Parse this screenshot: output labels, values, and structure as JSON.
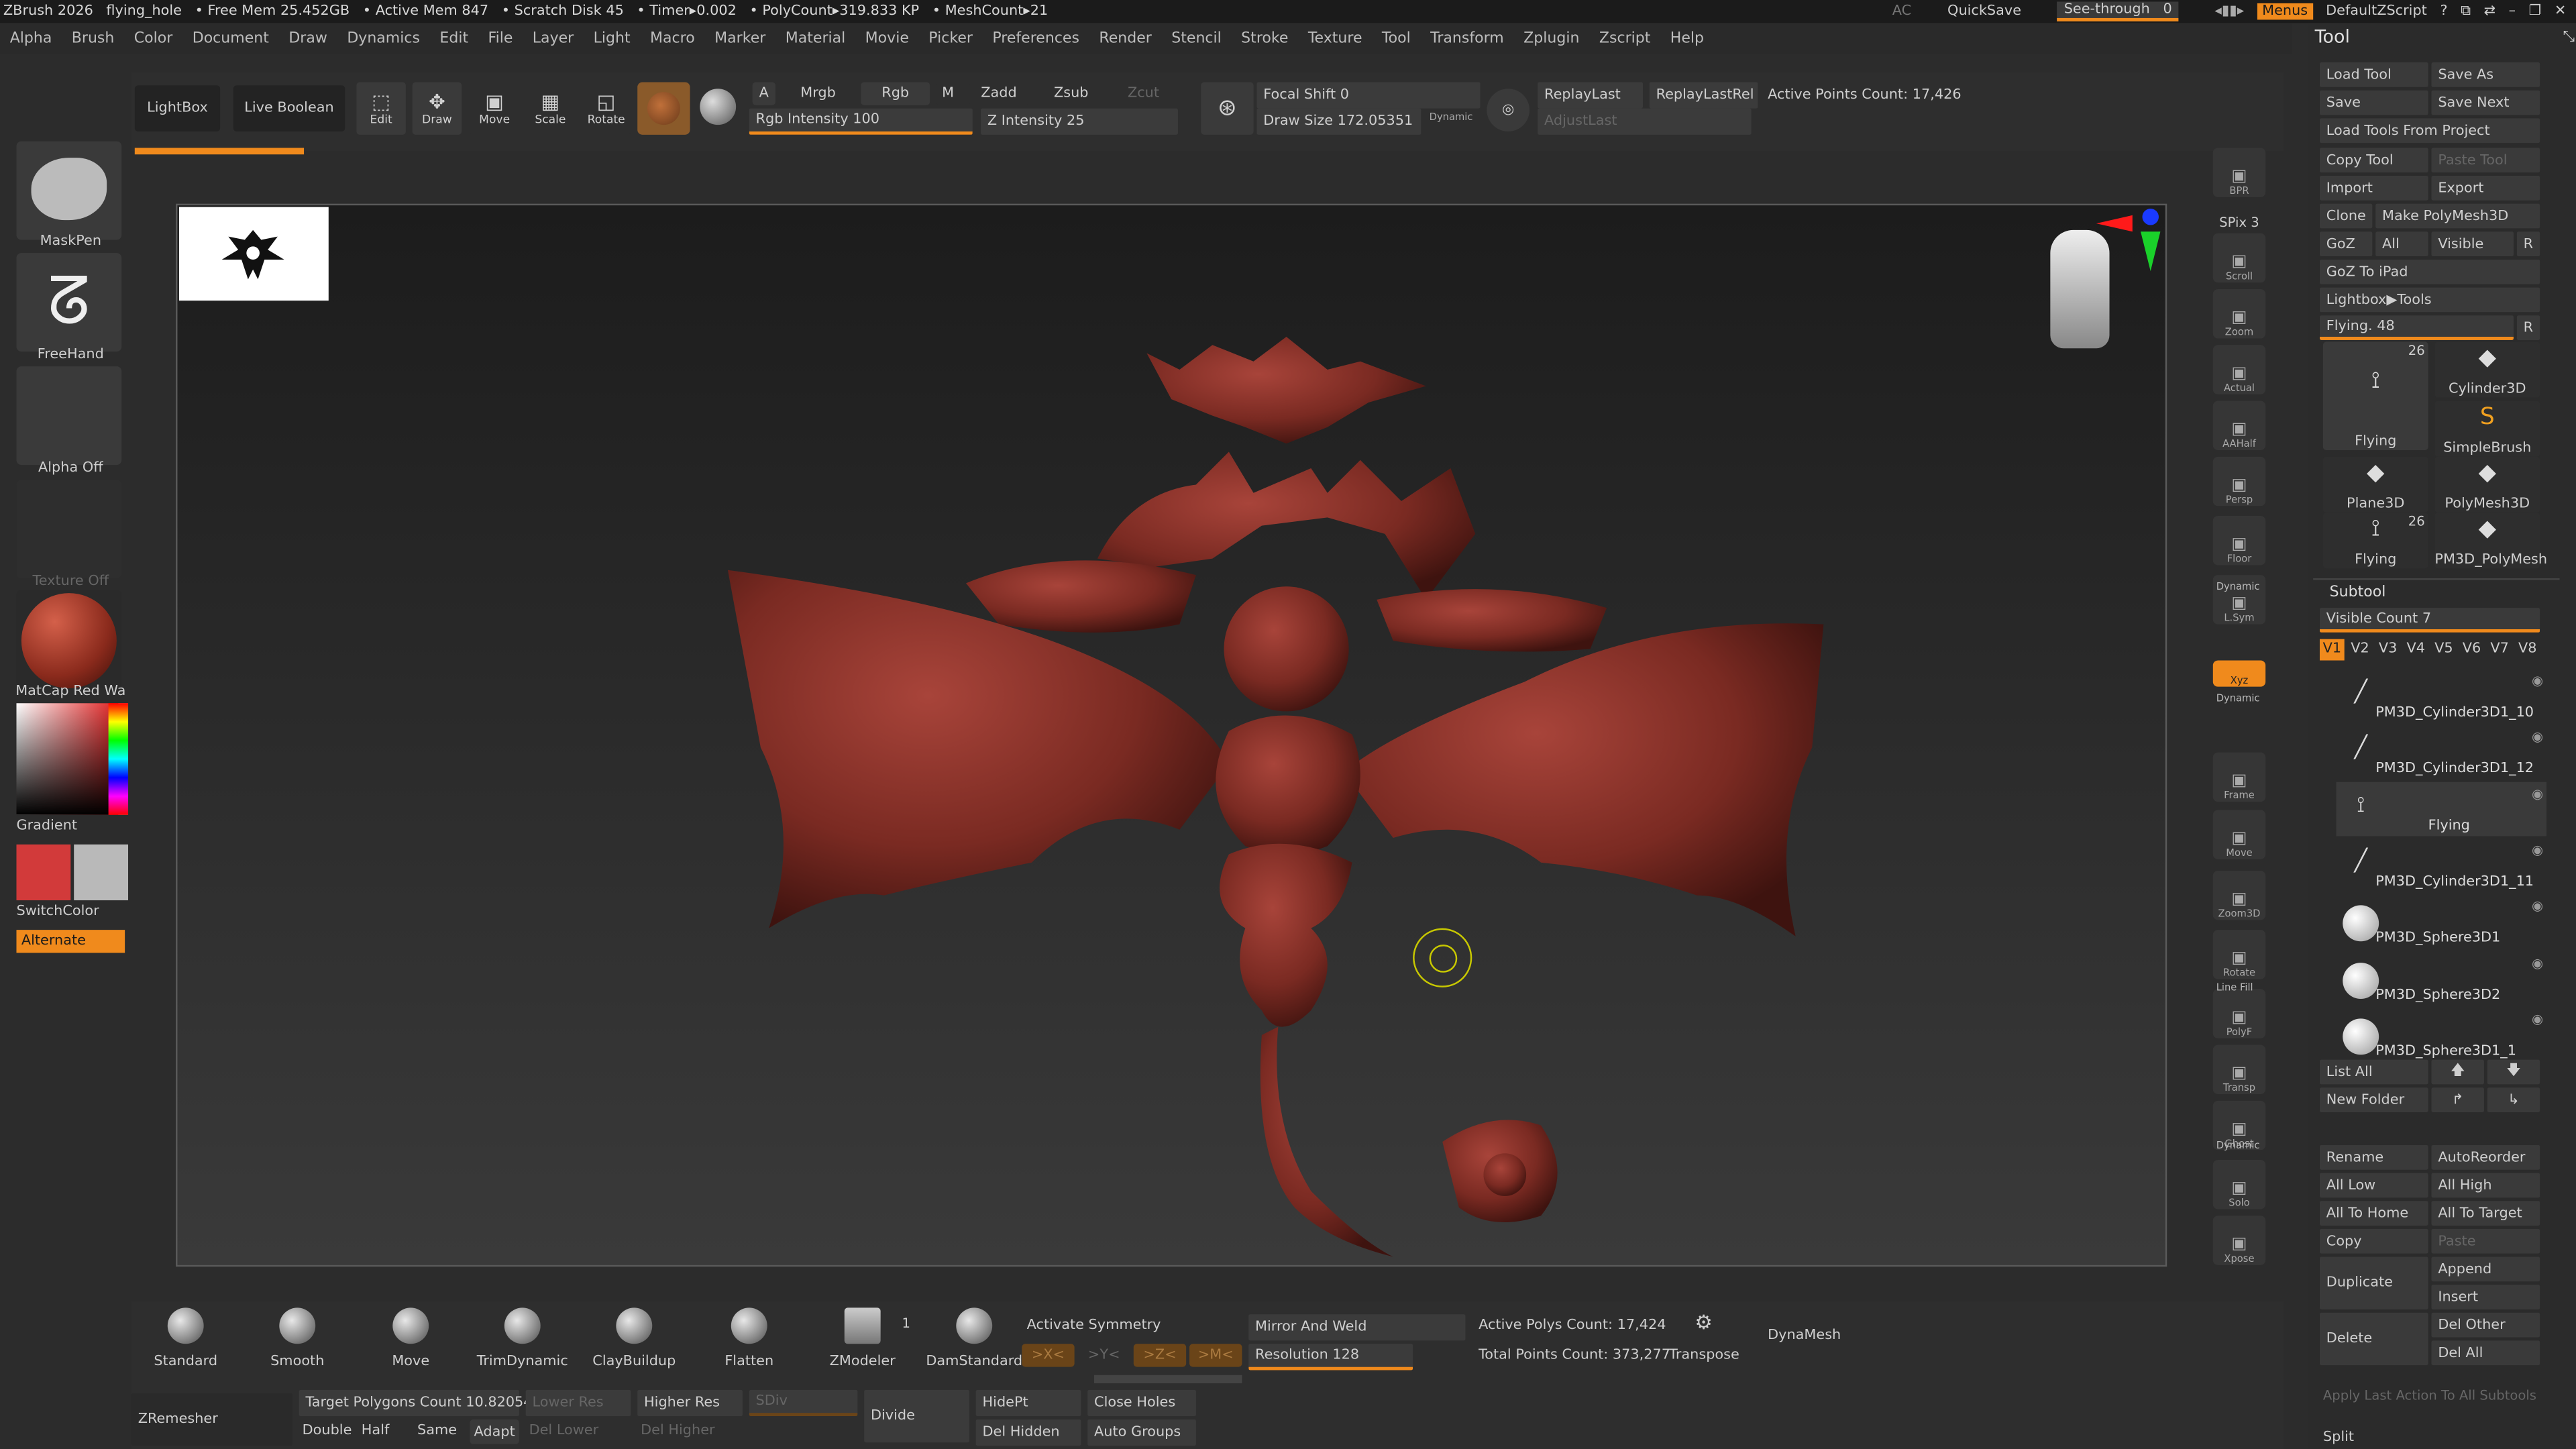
{
  "titlebar": {
    "app": "ZBrush 2026",
    "file": "flying_hole",
    "free_mem": "• Free Mem 25.452GB",
    "active_mem": "• Active Mem 847",
    "scratch": "• Scratch Disk 45",
    "timer": "• Timer▸0.002",
    "polycount": "• PolyCount▸319.833 KP",
    "meshcount": "• MeshCount▸21",
    "ac": "AC",
    "quicksave": "QuickSave",
    "seethrough": "See-through",
    "seethrough_val": "0",
    "menus": "Menus",
    "zscript": "DefaultZScript"
  },
  "menubar": [
    "Alpha",
    "Brush",
    "Color",
    "Document",
    "Draw",
    "Dynamics",
    "Edit",
    "File",
    "Layer",
    "Light",
    "Macro",
    "Marker",
    "Material",
    "Movie",
    "Picker",
    "Preferences",
    "Render",
    "Stencil",
    "Stroke",
    "Texture",
    "Tool",
    "Transform",
    "Zplugin",
    "Zscript",
    "Help"
  ],
  "toolbar": {
    "lightbox": "LightBox",
    "live_boolean": "Live Boolean",
    "edit": "Edit",
    "draw": "Draw",
    "move": "Move",
    "scale": "Scale",
    "rotate": "Rotate",
    "a": "A",
    "mrgb": "Mrgb",
    "rgb": "Rgb",
    "m": "M",
    "zadd": "Zadd",
    "zsub": "Zsub",
    "zcut": "Zcut",
    "rgb_intensity": "Rgb Intensity 100",
    "z_intensity": "Z Intensity 25",
    "focal_shift": "Focal Shift 0",
    "draw_size": "Draw Size 172.05351",
    "dynamic": "Dynamic",
    "replay_last": "ReplayLast",
    "replay_last_rel": "ReplayLastRel",
    "active_points": "Active Points Count: 17,426",
    "adjust_last": "AdjustLast"
  },
  "leftpanel": {
    "brush": "MaskPen",
    "stroke": "FreeHand",
    "alpha": "Alpha Off",
    "texture": "Texture Off",
    "material": "MatCap Red Wa",
    "gradient": "Gradient",
    "switchcolor": "SwitchColor",
    "alternate": "Alternate"
  },
  "rightrail": [
    {
      "label": "BPR",
      "icon": "bpr-icon"
    },
    {
      "label": "SPix 3",
      "icon": "spix-icon"
    },
    {
      "label": "Scroll",
      "icon": "scroll-icon"
    },
    {
      "label": "Zoom",
      "icon": "zoom-icon"
    },
    {
      "label": "Actual",
      "icon": "actual-icon"
    },
    {
      "label": "AAHalf",
      "icon": "aahalf-icon"
    },
    {
      "label": "Persp",
      "icon": "persp-icon"
    },
    {
      "label": "Floor",
      "icon": "floor-icon"
    },
    {
      "label": "L.Sym",
      "icon": "lsym-icon"
    },
    {
      "label": "Xyz",
      "icon": "xyz-icon"
    },
    {
      "label": "Frame",
      "icon": "frame-icon"
    },
    {
      "label": "Move",
      "icon": "move-icon"
    },
    {
      "label": "Zoom3D",
      "icon": "zoom3d-icon"
    },
    {
      "label": "Rotate",
      "icon": "rotate-icon"
    },
    {
      "label": "PolyF",
      "icon": "polyf-icon"
    },
    {
      "label": "Transp",
      "icon": "transp-icon"
    },
    {
      "label": "Ghost",
      "icon": "ghost-icon"
    },
    {
      "label": "Solo",
      "icon": "solo-icon"
    },
    {
      "label": "Xpose",
      "icon": "xpose-icon"
    }
  ],
  "rail_dynamic": "Dynamic",
  "rail_linefill": "Line Fill",
  "toolpanel": {
    "title": "Tool",
    "load_tool": "Load Tool",
    "save_as": "Save As",
    "save": "Save",
    "save_next": "Save Next",
    "load_from_project": "Load Tools From Project",
    "copy_tool": "Copy Tool",
    "paste_tool": "Paste Tool",
    "import": "Import",
    "export": "Export",
    "clone": "Clone",
    "make_polymesh": "Make PolyMesh3D",
    "goz": "GoZ",
    "all": "All",
    "visible": "Visible",
    "r": "R",
    "goz_ipad": "GoZ To iPad",
    "lightbox_tools": "Lightbox▶Tools",
    "flying_slider": "Flying. 48",
    "tools": [
      {
        "label": "Flying",
        "badge": "26"
      },
      {
        "label": "Cylinder3D",
        "badge": ""
      },
      {
        "label": "SimpleBrush",
        "badge": ""
      },
      {
        "label": "Plane3D",
        "badge": ""
      },
      {
        "label": "PolyMesh3D",
        "badge": ""
      },
      {
        "label": "Flying",
        "badge": "26"
      },
      {
        "label": "PM3D_PolyMesh",
        "badge": ""
      }
    ],
    "subtool": "Subtool",
    "visible_count": "Visible Count 7",
    "views": [
      "V1",
      "V2",
      "V3",
      "V4",
      "V5",
      "V6",
      "V7",
      "V8"
    ],
    "subtools": [
      "PM3D_Cylinder3D1_10",
      "PM3D_Cylinder3D1_12",
      "Flying",
      "PM3D_Cylinder3D1_11",
      "PM3D_Sphere3D1",
      "PM3D_Sphere3D2",
      "PM3D_Sphere3D1_1"
    ],
    "list_all": "List All",
    "new_folder": "New Folder",
    "rename": "Rename",
    "autoreorder": "AutoReorder",
    "all_low": "All Low",
    "all_high": "All High",
    "all_to_home": "All To Home",
    "all_to_target": "All To Target",
    "copy": "Copy",
    "paste": "Paste",
    "duplicate": "Duplicate",
    "append": "Append",
    "insert": "Insert",
    "delete": "Delete",
    "del_other": "Del Other",
    "del_all": "Del All",
    "apply_last": "Apply Last Action To All Subtools",
    "split": "Split"
  },
  "bottombar": {
    "brushes": [
      "Standard",
      "Smooth",
      "Move",
      "TrimDynamic",
      "ClayBuildup",
      "Flatten",
      "ZModeler",
      "DamStandard"
    ],
    "zmodeler_badge": "1",
    "activate_symmetry": "Activate Symmetry",
    "sym_x": ">X<",
    "sym_y": ">Y<",
    "sym_z": ">Z<",
    "sym_m": ">M<",
    "mirror_weld": "Mirror And Weld",
    "resolution": "Resolution 128",
    "active_polys": "Active Polys Count: 17,424",
    "total_points": "Total Points Count: 373,277",
    "transpose": "Transpose",
    "dynamesh": "DynaMesh",
    "zremesher": "ZRemesher",
    "target_polys": "Target Polygons Count 10.82054",
    "lower_res": "Lower Res",
    "higher_res": "Higher Res",
    "sdiv": "SDiv",
    "divide": "Divide",
    "hidept": "HidePt",
    "close_holes": "Close Holes",
    "double": "Double",
    "half": "Half",
    "same": "Same",
    "adapt": "Adapt",
    "del_lower": "Del Lower",
    "del_higher": "Del Higher",
    "del_hidden": "Del Hidden",
    "auto_groups": "Auto Groups"
  },
  "colors": {
    "accent": "#f08a1c",
    "model": "#7a2a22",
    "primary_color": "#d23a3a",
    "secondary_color": "#b9b9b9"
  }
}
